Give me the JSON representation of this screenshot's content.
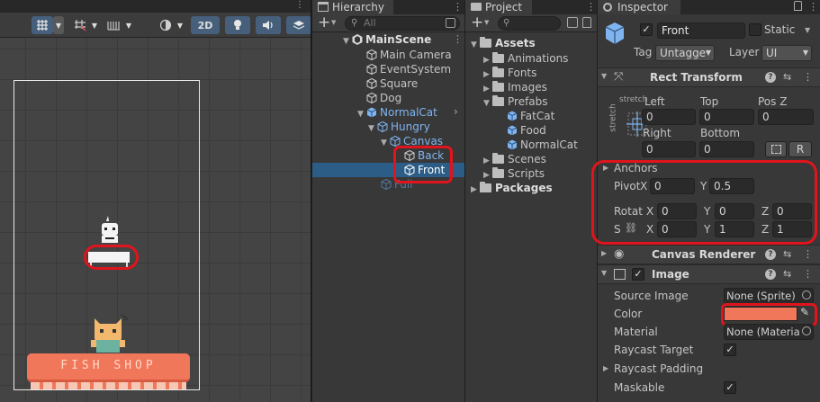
{
  "scene": {
    "toolbar": {
      "mode_2d": "2D"
    },
    "shop_sign": "FISH SHOP"
  },
  "hierarchy": {
    "tab_label": "Hierarchy",
    "search_placeholder": "All",
    "add_label": "+",
    "items": [
      {
        "label": "MainScene"
      },
      {
        "label": "Main Camera"
      },
      {
        "label": "EventSystem"
      },
      {
        "label": "Square"
      },
      {
        "label": "Dog"
      },
      {
        "label": "NormalCat"
      },
      {
        "label": "Hungry"
      },
      {
        "label": "Canvas"
      },
      {
        "label": "Back"
      },
      {
        "label": "Front"
      },
      {
        "label": "Full"
      }
    ]
  },
  "project": {
    "tab_label": "Project",
    "add_label": "+",
    "items": [
      {
        "label": "Assets"
      },
      {
        "label": "Animations"
      },
      {
        "label": "Fonts"
      },
      {
        "label": "Images"
      },
      {
        "label": "Prefabs"
      },
      {
        "label": "FatCat"
      },
      {
        "label": "Food"
      },
      {
        "label": "NormalCat"
      },
      {
        "label": "Scenes"
      },
      {
        "label": "Scripts"
      },
      {
        "label": "Packages"
      }
    ]
  },
  "inspector": {
    "tab_label": "Inspector",
    "object_name": "Front",
    "static_label": "Static",
    "tag_label": "Tag",
    "tag_value": "Untagge",
    "layer_label": "Layer",
    "layer_value": "UI",
    "rect_transform": {
      "title": "Rect Transform",
      "stretch_top": "stretch",
      "stretch_side": "stretch",
      "left_label": "Left",
      "top_label": "Top",
      "posz_label": "Pos Z",
      "left": "0",
      "top": "0",
      "posz": "0",
      "right_label": "Right",
      "bottom_label": "Bottom",
      "right": "0",
      "bottom": "0",
      "r_button": "R",
      "anchors_label": "Anchors",
      "pivot_label": "Pivot",
      "pivot_x": "0",
      "pivot_y": "0.5",
      "rotation_label": "Rotat",
      "rot_x": "0",
      "rot_y": "0",
      "rot_z": "0",
      "scale_label": "S",
      "scale_x": "0",
      "scale_y": "1",
      "scale_z": "1",
      "x": "X",
      "y": "Y",
      "z": "Z"
    },
    "canvas_renderer": {
      "title": "Canvas Renderer"
    },
    "image": {
      "title": "Image",
      "source_image_label": "Source Image",
      "source_image_value": "None (Sprite)",
      "color_label": "Color",
      "color_value": "#F0775A",
      "material_label": "Material",
      "material_value": "None (Materia",
      "raycast_target_label": "Raycast Target",
      "raycast_padding_label": "Raycast Padding",
      "maskable_label": "Maskable"
    }
  },
  "colors": {
    "selection": "#2C5D87",
    "prefab_blue": "#7FB4F0",
    "annotation_red": "#E0141C",
    "shop_salmon": "#F0775A"
  }
}
